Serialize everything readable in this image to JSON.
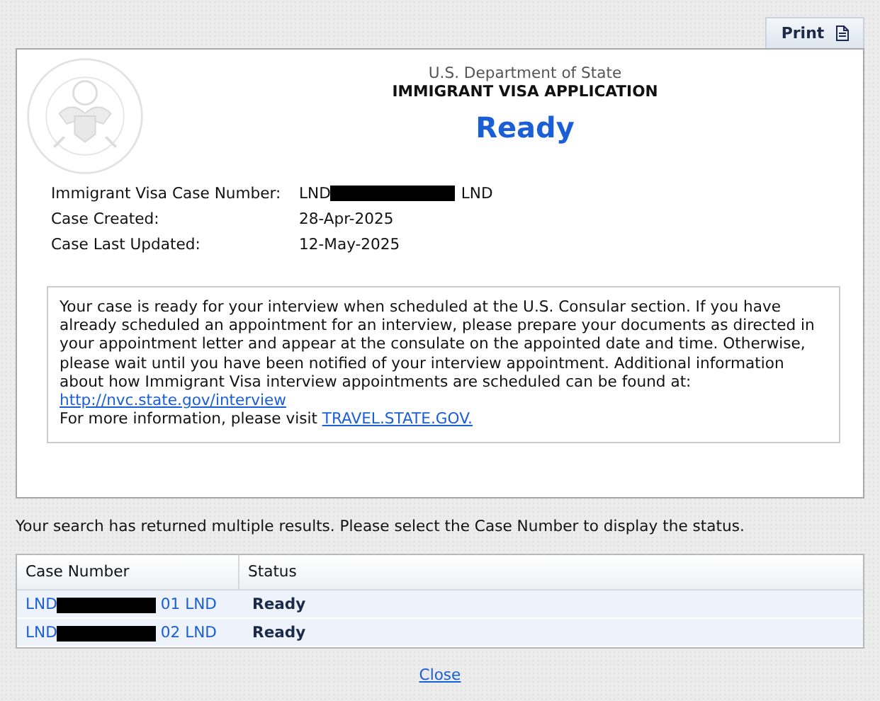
{
  "print_button": {
    "label": "Print"
  },
  "header": {
    "agency": "U.S. Department of State",
    "title": "IMMIGRANT VISA APPLICATION",
    "status": "Ready"
  },
  "case_info": [
    {
      "label": "Immigrant Visa Case Number:",
      "value_prefix": "LND",
      "redacted": true,
      "value_suffix": "LND"
    },
    {
      "label": "Case Created:",
      "value_prefix": "28-Apr-2025",
      "redacted": false
    },
    {
      "label": "Case Last Updated:",
      "value_prefix": "12-May-2025",
      "redacted": false
    }
  ],
  "message": {
    "text": "Your case is ready for your interview when scheduled at the U.S. Consular section. If you have already scheduled an appointment for an interview, please prepare your documents as directed in your appointment letter and appear at the consulate on the appointed date and time. Otherwise, please wait until you have been notified of your interview appointment. Additional information about how Immigrant Visa interview appointments are scheduled can be found at:",
    "link": "http://nvc.state.gov/interview",
    "more_text": "For more information, please visit",
    "more_link": "TRAVEL.STATE.GOV."
  },
  "results_note": "Your search has returned multiple results. Please select the Case Number to display the status.",
  "table": {
    "columns": [
      "Case Number",
      "Status"
    ],
    "rows": [
      {
        "case_prefix": "LND",
        "redacted": true,
        "case_suffix": "01 LND",
        "status": "Ready"
      },
      {
        "case_prefix": "LND",
        "redacted": true,
        "case_suffix": "02 LND",
        "status": "Ready"
      }
    ]
  },
  "close_link": "Close"
}
